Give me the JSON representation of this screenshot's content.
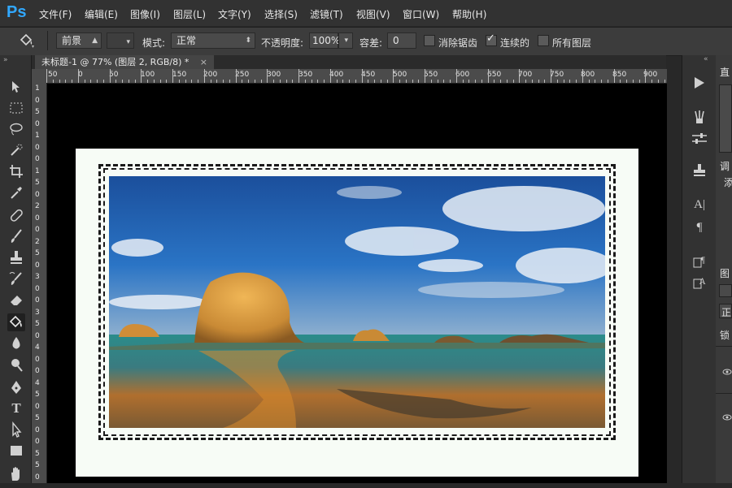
{
  "app": {
    "logo": "Ps"
  },
  "menu": [
    "文件(F)",
    "编辑(E)",
    "图像(I)",
    "图层(L)",
    "文字(Y)",
    "选择(S)",
    "滤镜(T)",
    "视图(V)",
    "窗口(W)",
    "帮助(H)"
  ],
  "options": {
    "fill_source": "前景",
    "mode_label": "模式:",
    "mode_value": "正常",
    "opacity_label": "不透明度:",
    "opacity_value": "100%",
    "tolerance_label": "容差:",
    "tolerance_value": "0",
    "antialias_label": "消除锯齿",
    "antialias_checked": false,
    "contiguous_label": "连续的",
    "contiguous_checked": true,
    "all_layers_label": "所有图层",
    "all_layers_checked": false
  },
  "document": {
    "tab_title": "未标题-1 @ 77% (图层 2, RGB/8) *",
    "close": "×"
  },
  "ruler_top": [
    "50",
    "0",
    "50",
    "100",
    "150",
    "200",
    "250",
    "300",
    "350",
    "400",
    "450",
    "500",
    "550",
    "600",
    "650",
    "700",
    "750",
    "800",
    "850",
    "900"
  ],
  "ruler_left": [
    "1",
    "0",
    "5",
    "0",
    "1",
    "0",
    "0",
    "1",
    "5",
    "0",
    "2",
    "0",
    "0",
    "2",
    "5",
    "0",
    "3",
    "0",
    "0",
    "3",
    "5",
    "0",
    "4",
    "0",
    "0",
    "4",
    "5",
    "0",
    "5",
    "0",
    "0",
    "5",
    "5",
    "0"
  ],
  "tools": [
    "move-tool-icon",
    "marquee-tool-icon",
    "lasso-tool-icon",
    "quick-select-icon",
    "crop-tool-icon",
    "eyedropper-icon",
    "healing-brush-icon",
    "brush-tool-icon",
    "clone-stamp-icon",
    "history-brush-icon",
    "eraser-icon",
    "paint-bucket-icon",
    "blur-tool-icon",
    "dodge-tool-icon",
    "pen-tool-icon",
    "type-tool-icon",
    "path-select-icon",
    "rectangle-tool-icon",
    "hand-tool-icon"
  ],
  "type_tool_glyph": "T",
  "dock": {
    "char_glyph": "A|",
    "para_glyph": "¶"
  },
  "panels": {
    "histogram_head": "直",
    "adjust_head": "调",
    "adjust_sub": "添",
    "layers_head": "图",
    "layers_blend": "正",
    "lock_label": "锁"
  }
}
